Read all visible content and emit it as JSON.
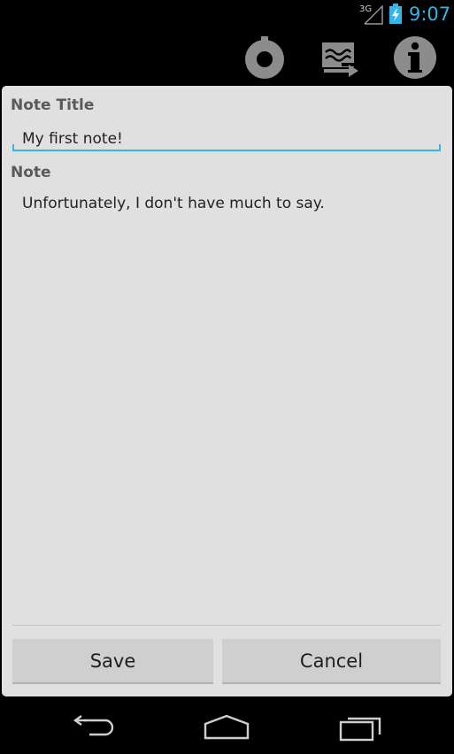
{
  "status_bar": {
    "network": "3G",
    "time": "9:07",
    "icons": [
      "signal-icon",
      "battery-charging-icon"
    ]
  },
  "action_bar": {
    "icons": [
      "revert-icon",
      "export-icon",
      "info-icon"
    ]
  },
  "form": {
    "title_label": "Note Title",
    "title_value": "My first note!",
    "note_label": "Note",
    "note_value": "Unfortunately, I don't have much to say."
  },
  "buttons": {
    "save": "Save",
    "cancel": "Cancel"
  },
  "nav_bar": {
    "icons": [
      "back-icon",
      "home-icon",
      "recent-apps-icon"
    ]
  },
  "colors": {
    "accent": "#33b5e5",
    "dialog_bg": "#e0e0e0",
    "button_bg": "#cfcfcf"
  }
}
